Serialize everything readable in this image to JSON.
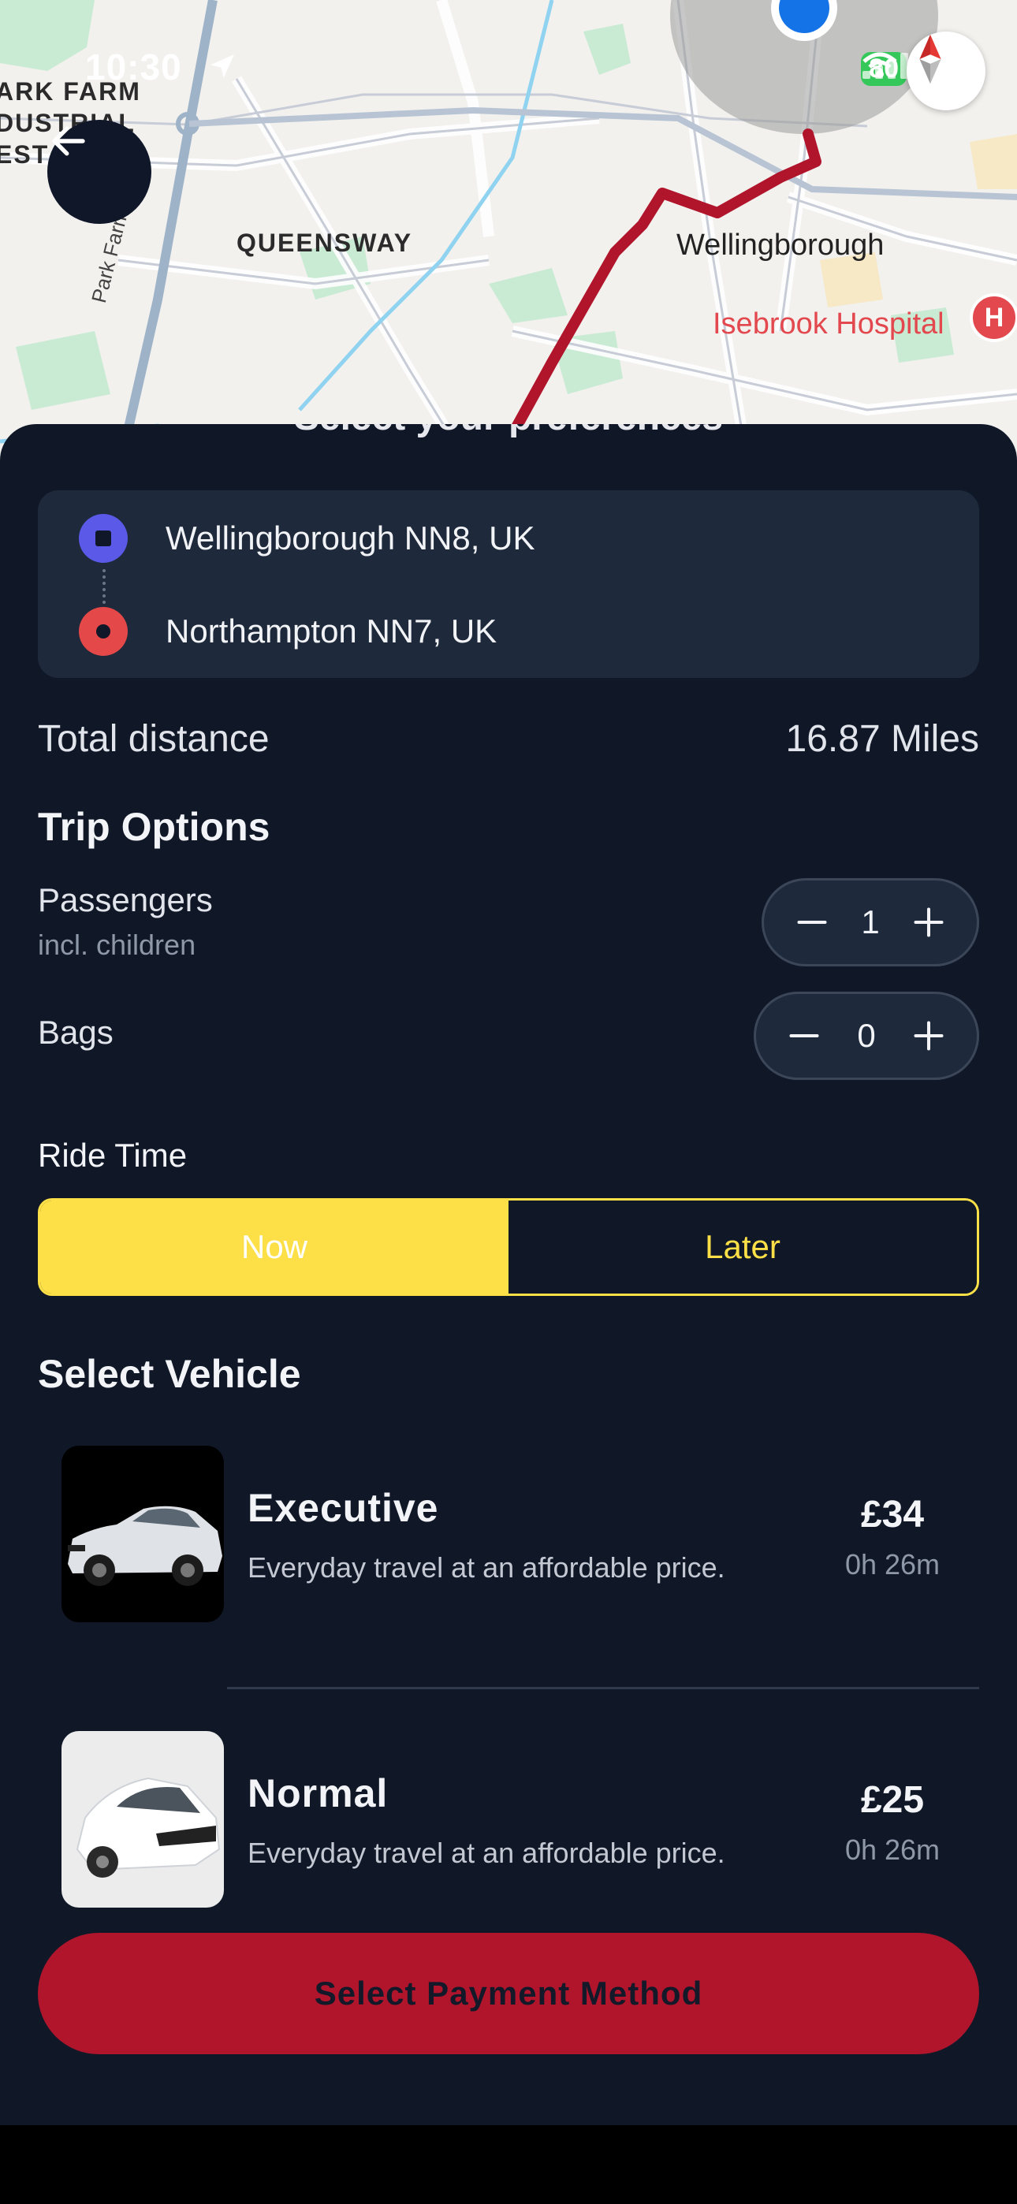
{
  "status_bar": {
    "time": "10:30",
    "battery": "80"
  },
  "map": {
    "labels": {
      "area_top_left": "ARK FARM\nDUSTRIAL\nEST",
      "queensway": "QUEENSWAY",
      "park_farm_way": "Park Farm Way",
      "town": "Wellingborough",
      "hospital": "Isebrook Hospital"
    },
    "hospital_badge": "H"
  },
  "sheet": {
    "peek_title": "Select your preferences",
    "route": {
      "origin": "Wellingborough NN8, UK",
      "destination": "Northampton NN7, UK"
    },
    "distance": {
      "label": "Total distance",
      "value": "16.87 Miles"
    },
    "trip_options": {
      "title": "Trip Options",
      "passengers": {
        "label": "Passengers",
        "sublabel": "incl. children",
        "value": "1"
      },
      "bags": {
        "label": "Bags",
        "value": "0"
      }
    },
    "ride_time": {
      "title": "Ride Time",
      "now": "Now",
      "later": "Later",
      "selected": "Now"
    },
    "vehicles": {
      "title": "Select Vehicle",
      "items": [
        {
          "name": "Executive",
          "description": "Everyday travel at an affordable price.",
          "price": "£34",
          "eta": "0h 26m"
        },
        {
          "name": "Normal",
          "description": "Everyday travel at an affordable price.",
          "price": "£25",
          "eta": "0h 26m"
        }
      ]
    },
    "payment_button": "Select Payment Method"
  },
  "colors": {
    "sheet_bg": "#101828",
    "card_bg": "#1e2a3b",
    "accent_yellow": "#fde047",
    "route_red": "#b0152c",
    "origin_blue": "#5b5ae8",
    "destination_red": "#e54848"
  }
}
